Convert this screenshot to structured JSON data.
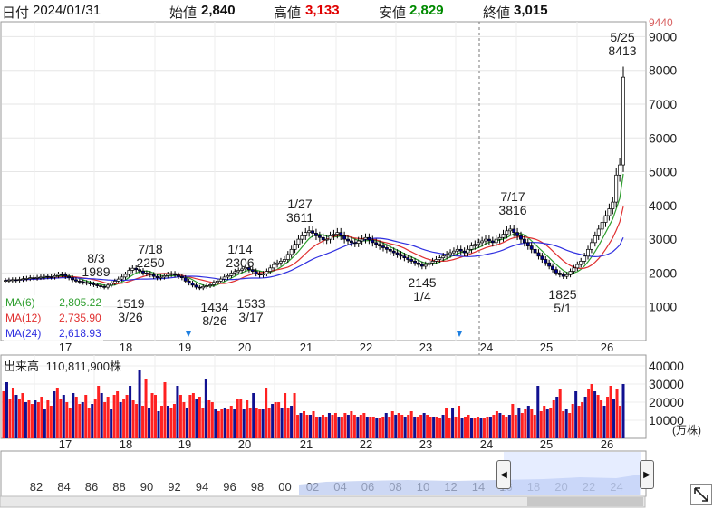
{
  "header": {
    "date_label": "日付",
    "date": "2024/01/31",
    "open_label": "始値",
    "open": "2,840",
    "high_label": "高値",
    "high": "3,133",
    "low_label": "安値",
    "low": "2,829",
    "close_label": "終値",
    "close": "3,015"
  },
  "colors": {
    "up": "#e00000",
    "down": "#00008b",
    "ma6": "#2e9e2e",
    "ma12": "#e03030",
    "ma24": "#3030e0",
    "volume_up": "#ff2020",
    "volume_down": "#101090"
  },
  "price_axis": {
    "ticks": [
      "1000",
      "2000",
      "3000",
      "4000",
      "5000",
      "6000",
      "7000",
      "8000",
      "9000"
    ],
    "top_label": "9440"
  },
  "volume_axis": {
    "ticks": [
      "10000",
      "20000",
      "30000",
      "40000"
    ],
    "unit": "(万株)"
  },
  "x_labels": [
    "17",
    "18",
    "19",
    "20",
    "21",
    "22",
    "23",
    "24",
    "25",
    "26"
  ],
  "ma_legend": [
    {
      "name": "MA(6)",
      "value": "2,805.22"
    },
    {
      "name": "MA(12)",
      "value": "2,735.90"
    },
    {
      "name": "MA(24)",
      "value": "2,618.93"
    }
  ],
  "volume_title": "出来高",
  "volume_value": "110,811,900株",
  "annotations": [
    {
      "line1": "8/3",
      "line2": "1989"
    },
    {
      "line1": "7/18",
      "line2": "2250"
    },
    {
      "line1": "1519",
      "line2": "3/26"
    },
    {
      "line1": "1434",
      "line2": "8/26"
    },
    {
      "line1": "1/14",
      "line2": "2306"
    },
    {
      "line1": "1533",
      "line2": "3/17"
    },
    {
      "line1": "1/27",
      "line2": "3611"
    },
    {
      "line1": "2145",
      "line2": "1/4"
    },
    {
      "line1": "7/17",
      "line2": "3816"
    },
    {
      "line1": "1825",
      "line2": "5/1"
    },
    {
      "line1": "5/25",
      "line2": "8413"
    }
  ],
  "navigator": {
    "years": [
      "82",
      "84",
      "86",
      "88",
      "90",
      "92",
      "94",
      "96",
      "98",
      "00",
      "02",
      "04",
      "06",
      "08",
      "10",
      "12",
      "14",
      "16",
      "18",
      "20",
      "22",
      "24"
    ]
  },
  "chart_data": {
    "type": "candlestick",
    "y_range": [
      0,
      9440
    ],
    "x_axis_years": [
      "17",
      "18",
      "19",
      "20",
      "21",
      "22",
      "23",
      "24",
      "25",
      "26"
    ],
    "marked_extremes": [
      {
        "date": "8/3",
        "value": 1989,
        "kind": "high"
      },
      {
        "date": "7/18",
        "value": 2250,
        "kind": "high"
      },
      {
        "date": "3/26",
        "value": 1519,
        "kind": "low"
      },
      {
        "date": "8/26",
        "value": 1434,
        "kind": "low"
      },
      {
        "date": "1/14",
        "value": 2306,
        "kind": "high"
      },
      {
        "date": "3/17",
        "value": 1533,
        "kind": "low"
      },
      {
        "date": "1/27",
        "value": 3611,
        "kind": "high"
      },
      {
        "date": "1/4",
        "value": 2145,
        "kind": "low"
      },
      {
        "date": "7/17",
        "value": 3816,
        "kind": "high"
      },
      {
        "date": "5/1",
        "value": 1825,
        "kind": "low"
      },
      {
        "date": "5/25",
        "value": 8413,
        "kind": "high"
      }
    ],
    "close_series": [
      1780,
      1790,
      1800,
      1790,
      1810,
      1830,
      1840,
      1860,
      1850,
      1870,
      1880,
      1900,
      1890,
      1880,
      1920,
      1960,
      1950,
      1900,
      1860,
      1800,
      1760,
      1740,
      1720,
      1700,
      1680,
      1650,
      1620,
      1600,
      1580,
      1640,
      1700,
      1760,
      1820,
      1880,
      1960,
      2080,
      2140,
      2100,
      2060,
      2000,
      1980,
      1950,
      1900,
      1860,
      1880,
      1920,
      1960,
      1980,
      1940,
      1900,
      1860,
      1760,
      1700,
      1640,
      1580,
      1560,
      1600,
      1620,
      1650,
      1720,
      1760,
      1820,
      1880,
      1920,
      2000,
      2040,
      2080,
      2120,
      2160,
      2100,
      2050,
      1980,
      1940,
      1980,
      2050,
      2150,
      2250,
      2300,
      2350,
      2400,
      2550,
      2700,
      2850,
      3000,
      3100,
      3200,
      3250,
      3180,
      3100,
      3050,
      2980,
      3000,
      3100,
      3150,
      3200,
      3100,
      3000,
      2950,
      2900,
      2880,
      2950,
      3000,
      3050,
      2980,
      2900,
      2850,
      2800,
      2750,
      2700,
      2650,
      2600,
      2550,
      2500,
      2450,
      2400,
      2350,
      2300,
      2250,
      2200,
      2250,
      2300,
      2350,
      2400,
      2450,
      2500,
      2550,
      2600,
      2650,
      2700,
      2650,
      2600,
      2700,
      2800,
      2850,
      2900,
      2950,
      3000,
      2950,
      2900,
      3000,
      3050,
      3150,
      3250,
      3300,
      3200,
      3100,
      3000,
      2900,
      2800,
      2700,
      2600,
      2500,
      2400,
      2300,
      2200,
      2100,
      2000,
      1950,
      1900,
      1950,
      2050,
      2150,
      2250,
      2350,
      2500,
      2700,
      2900,
      3100,
      3300,
      3500,
      3700,
      3900,
      4100,
      4900,
      5200,
      7800
    ],
    "volume_series": [
      26000,
      31000,
      22000,
      28000,
      24000,
      22000,
      25000,
      20000,
      21000,
      19000,
      21000,
      20000,
      23000,
      16000,
      21000,
      18000,
      26000,
      28000,
      22000,
      24000,
      20000,
      17000,
      25000,
      23000,
      19000,
      20000,
      24000,
      17000,
      19000,
      22000,
      29000,
      25000,
      20000,
      23000,
      16000,
      24000,
      26000,
      20000,
      22000,
      24000,
      29000,
      21000,
      19000,
      38000,
      18000,
      33000,
      17000,
      25000,
      24000,
      15000,
      18000,
      31000,
      18000,
      17000,
      19000,
      29000,
      24000,
      20000,
      17000,
      24000,
      25000,
      22000,
      23000,
      17000,
      33000,
      21000,
      20000,
      16000,
      15000,
      16000,
      17000,
      16000,
      18000,
      16000,
      22000,
      22000,
      16000,
      21000,
      17000,
      25000,
      17000,
      16000,
      16000,
      28000,
      17000,
      19000,
      20000,
      20000,
      17000,
      25000,
      17000,
      18000,
      25000,
      13000,
      14000,
      15000,
      13000,
      13000,
      15000,
      12000,
      12000,
      13000,
      12000,
      14000,
      13000,
      14000,
      12000,
      12000,
      14000,
      13000,
      15000,
      13000,
      12000,
      13000,
      14000,
      12000,
      12000,
      12000,
      11000,
      11000,
      12000,
      14000,
      12000,
      15000,
      13000,
      14000,
      13000,
      12000,
      13000,
      15000,
      12000,
      12000,
      13000,
      14000,
      13000,
      12000,
      12000,
      12000,
      11000,
      13000,
      17000,
      11000,
      17000,
      12000,
      18000,
      11000,
      12000,
      13000,
      11000,
      11000,
      12000,
      11000,
      11000,
      12000,
      12000,
      13000,
      15000,
      14000,
      13000,
      12000,
      13000,
      19000,
      13000,
      17000,
      14000,
      16000,
      18000,
      16000,
      13000,
      29000,
      15000,
      18000,
      16000,
      17000,
      21000,
      23000,
      27000,
      15000,
      16000,
      14000,
      19000,
      26000,
      18000,
      20000,
      23000,
      27000,
      30000,
      26000,
      24000,
      21000,
      18000,
      23000,
      29000,
      22000,
      27000,
      18000,
      30000
    ]
  }
}
